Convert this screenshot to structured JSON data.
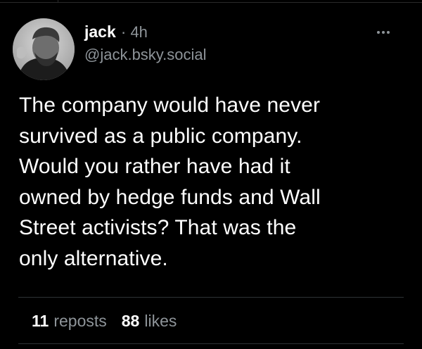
{
  "post": {
    "author": {
      "display_name": "jack",
      "separator": "·",
      "time": "4h",
      "handle": "@jack.bsky.social",
      "avatar_icon": "profile-photo"
    },
    "more_icon": "ellipsis-icon",
    "text": "The company would have never\nsurvived as a public company.\nWould you rather have had it\nowned by hedge funds and Wall\nStreet activists? That was the\nonly alternative.",
    "stats": {
      "reposts_count": "11",
      "reposts_label": "reposts",
      "likes_count": "88",
      "likes_label": "likes"
    }
  },
  "colors": {
    "background": "#000000",
    "text_primary": "#ffffff",
    "text_secondary": "#8e9499",
    "divider": "#2e3336"
  }
}
